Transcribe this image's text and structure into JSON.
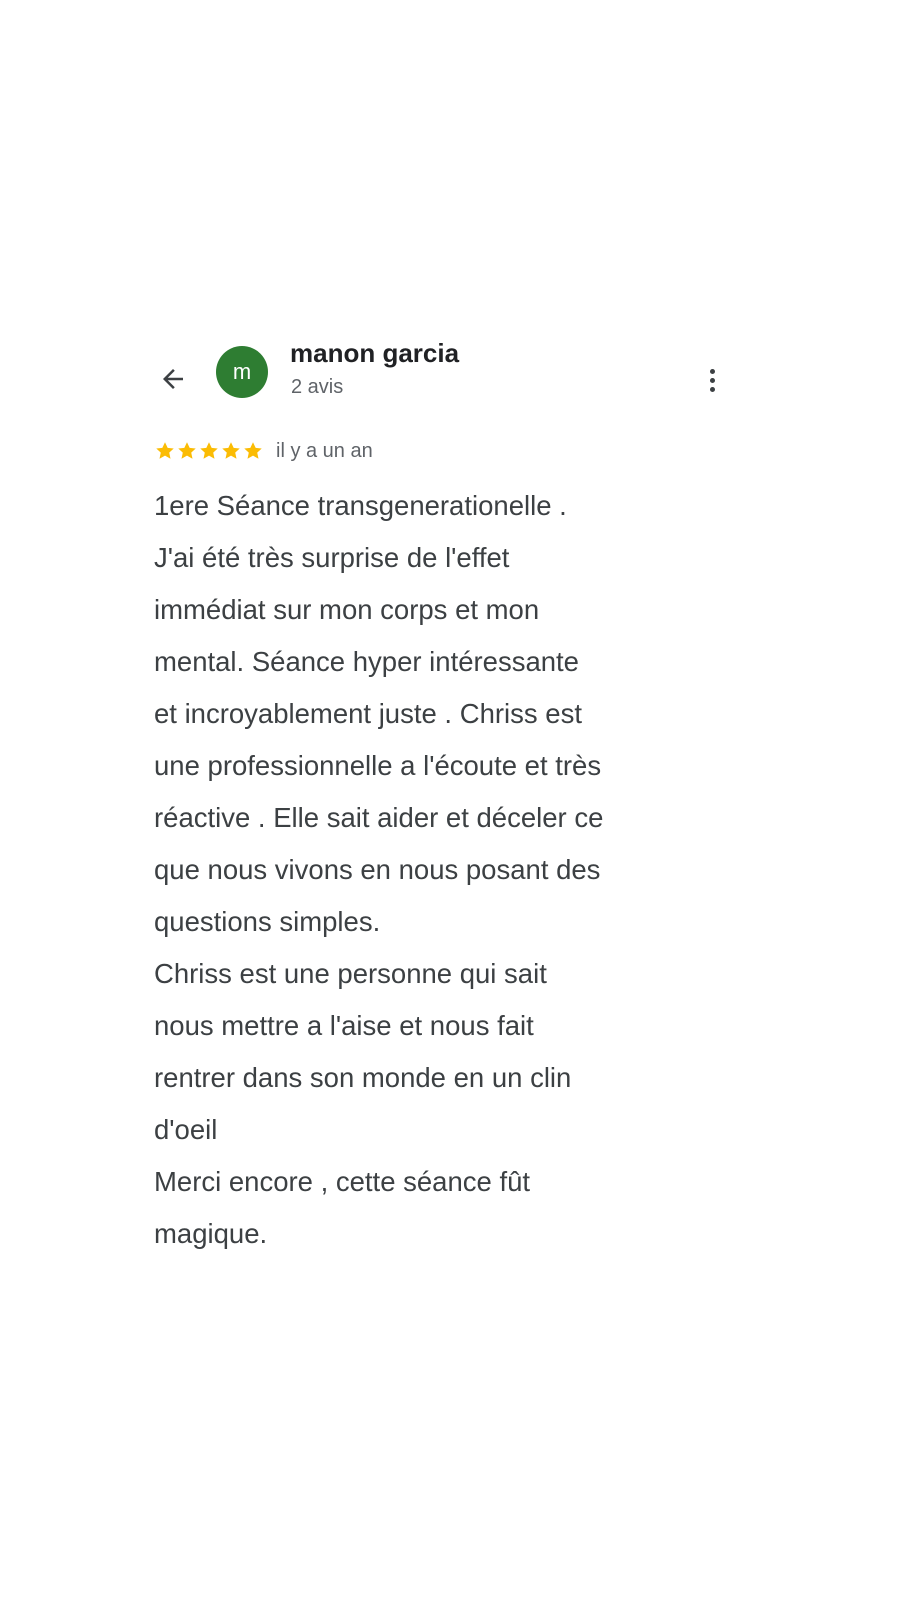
{
  "review": {
    "author": {
      "name": "manon garcia",
      "initial": "m",
      "review_count": "2 avis",
      "avatar_color": "#2e7d32"
    },
    "rating": {
      "stars": 5,
      "max_stars": 5,
      "star_color": "#fbbc04",
      "time_ago": "il y a un an"
    },
    "text_lines": [
      "1ere Séance transgenerationelle .",
      "J'ai été très surprise de l'effet",
      "immédiat sur mon corps et mon",
      "mental. Séance hyper intéressante",
      "et incroyablement juste . Chriss est",
      "une professionnelle a l'écoute et très",
      "réactive . Elle sait aider et déceler ce",
      "que nous vivons en nous posant des",
      "questions simples.",
      "Chriss est une personne qui sait",
      "nous mettre a l'aise et nous fait",
      "rentrer dans son monde en un clin",
      "d'oeil",
      "Merci encore , cette séance fût",
      "magique."
    ]
  },
  "icons": {
    "back": "arrow-back-icon",
    "more": "more-vert-icon",
    "star": "star-icon"
  }
}
